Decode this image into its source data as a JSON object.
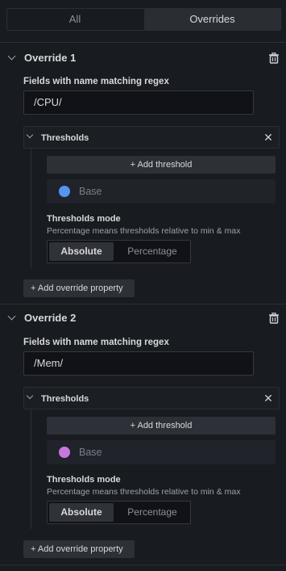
{
  "tabs": [
    {
      "label": "All",
      "active": false
    },
    {
      "label": "Overrides",
      "active": true
    }
  ],
  "overrides": [
    {
      "title": "Override 1",
      "matcher_label": "Fields with name matching regex",
      "matcher_value": "/CPU/",
      "property": {
        "title": "Thresholds",
        "add_threshold_label": "+ Add threshold",
        "base_label": "Base",
        "base_color": "#5794f2",
        "mode_title": "Thresholds mode",
        "mode_description": "Percentage means thresholds relative to min & max",
        "mode_options": [
          "Absolute",
          "Percentage"
        ],
        "mode_selected": "Absolute"
      },
      "add_property_label": "+ Add override property"
    },
    {
      "title": "Override 2",
      "matcher_label": "Fields with name matching regex",
      "matcher_value": "/Mem/",
      "property": {
        "title": "Thresholds",
        "add_threshold_label": "+ Add threshold",
        "base_label": "Base",
        "base_color": "#c678dd",
        "mode_title": "Thresholds mode",
        "mode_description": "Percentage means thresholds relative to min & max",
        "mode_options": [
          "Absolute",
          "Percentage"
        ],
        "mode_selected": "Absolute"
      },
      "add_property_label": "+ Add override property"
    }
  ],
  "icons": {
    "collapse": "chevron-down-icon",
    "delete": "trash-icon",
    "remove": "close-icon"
  }
}
